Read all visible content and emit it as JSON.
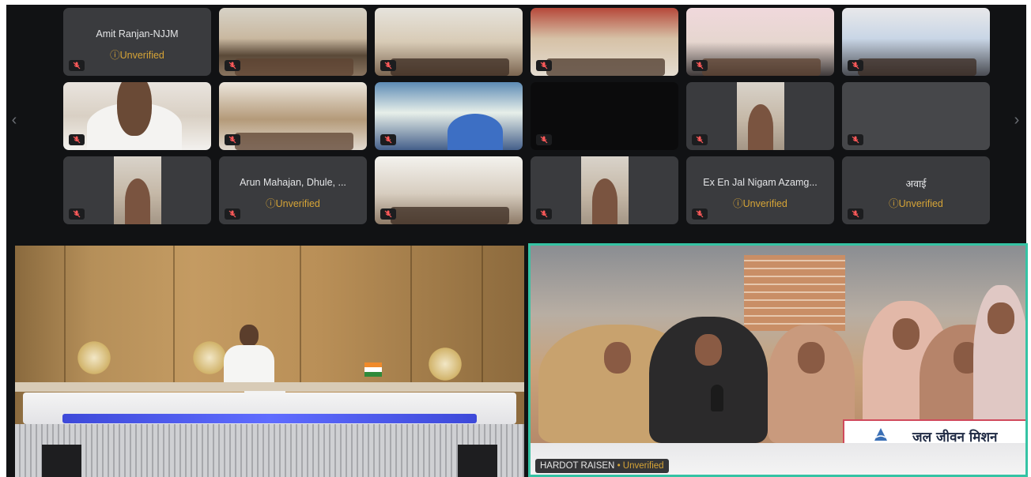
{
  "thumbnails": [
    {
      "type": "name",
      "name": "Amit Ranjan-NJJM",
      "status": "Unverified"
    },
    {
      "type": "video",
      "scene": "conf-a"
    },
    {
      "type": "video",
      "scene": "conf-b"
    },
    {
      "type": "video",
      "scene": "conf-c"
    },
    {
      "type": "video",
      "scene": "conf-d"
    },
    {
      "type": "video",
      "scene": "conf-e"
    },
    {
      "type": "video",
      "scene": "man"
    },
    {
      "type": "video",
      "scene": "office"
    },
    {
      "type": "video",
      "scene": "desk"
    },
    {
      "type": "black"
    },
    {
      "type": "camera"
    },
    {
      "type": "plain"
    },
    {
      "type": "camera"
    },
    {
      "type": "name",
      "name": "Arun Mahajan, Dhule, ...",
      "status": "Unverified"
    },
    {
      "type": "video",
      "scene": "room"
    },
    {
      "type": "camera"
    },
    {
      "type": "name",
      "name": "Ex En Jal Nigam Azamg...",
      "status": "Unverified"
    },
    {
      "type": "name",
      "name": "अवाई",
      "status": "Unverified"
    }
  ],
  "main_right": {
    "banner_text": "जल जीवन मिशन",
    "participant_name": "HARDOT RAISEN",
    "participant_status": "Unverified"
  },
  "colors": {
    "unverified": "#d6a437",
    "active_speaker_border": "#35c3a4",
    "muted_icon": "#ff5a5a"
  },
  "icons": {
    "mic_muted": "mic-off-icon",
    "unverified": "info-circle-icon",
    "nav_left": "chevron-left-icon",
    "nav_right": "chevron-right-icon"
  }
}
